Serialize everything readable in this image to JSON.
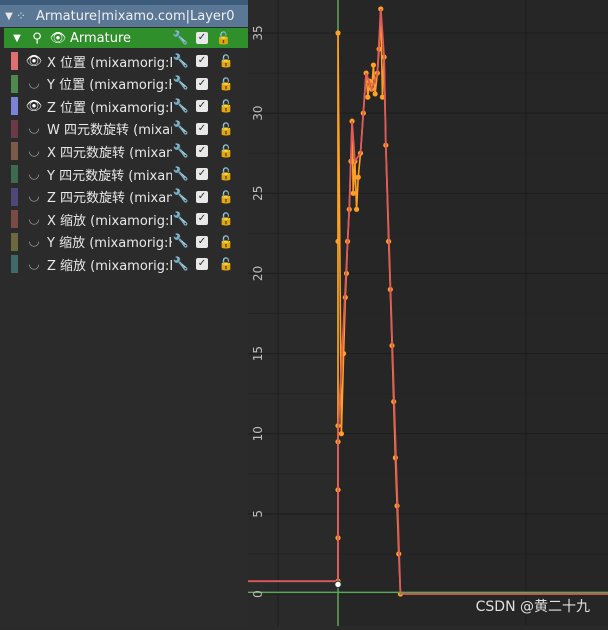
{
  "panel": {
    "action": {
      "label": "Armature|mixamo.com|Layer0"
    },
    "object": {
      "label": "Armature"
    },
    "channels": [
      {
        "label": "X 位置 (mixamorig:H",
        "color": "#e07070",
        "visible": true
      },
      {
        "label": "Y 位置 (mixamorig:H",
        "color": "#4e8a4e",
        "visible": false
      },
      {
        "label": "Z 位置 (mixamorig:H",
        "color": "#7b83d8",
        "visible": true
      },
      {
        "label": "W 四元数旋转 (mixar",
        "color": "#6a3a48",
        "visible": false
      },
      {
        "label": "X 四元数旋转 (mixan",
        "color": "#7a5a48",
        "visible": false
      },
      {
        "label": "Y 四元数旋转 (mixan",
        "color": "#3e6a50",
        "visible": false
      },
      {
        "label": "Z 四元数旋转 (mixan",
        "color": "#4e4878",
        "visible": false
      },
      {
        "label": "X 缩放 (mixamorig:H",
        "color": "#7a4a44",
        "visible": false
      },
      {
        "label": "Y 缩放 (mixamorig:H",
        "color": "#6a6a3e",
        "visible": false
      },
      {
        "label": "Z 缩放 (mixamorig:H",
        "color": "#3e6a6a",
        "visible": false
      }
    ],
    "icons": {
      "eye": "eye-icon",
      "wrench": "wrench-icon",
      "check": "checkbox-icon",
      "lock": "unlock-icon"
    }
  },
  "chart_data": {
    "type": "line",
    "ylim": [
      -0.5,
      37
    ],
    "y_ticks": [
      "0",
      "5",
      "10",
      "15",
      "20",
      "25",
      "30",
      "35"
    ],
    "y_tick_values": [
      0,
      5,
      10,
      15,
      20,
      25,
      30,
      35
    ],
    "series": [
      {
        "color": "#ffa024",
        "points": [
          [
            0,
            0.8
          ],
          [
            0,
            3.5
          ],
          [
            0,
            6.5
          ],
          [
            0,
            9.5
          ],
          [
            0,
            10.5
          ],
          [
            0,
            22
          ],
          [
            0,
            35
          ],
          [
            0.6,
            10
          ],
          [
            1,
            15
          ],
          [
            1.3,
            18.5
          ],
          [
            1.5,
            20
          ],
          [
            1.7,
            22
          ],
          [
            2,
            24
          ],
          [
            2.3,
            27
          ],
          [
            2.5,
            29.5
          ],
          [
            2.7,
            25
          ],
          [
            3,
            27
          ],
          [
            3.3,
            24
          ],
          [
            3.6,
            26
          ],
          [
            4,
            27.5
          ],
          [
            4.5,
            30
          ],
          [
            5,
            32.5
          ],
          [
            5.3,
            31
          ],
          [
            5.6,
            32
          ],
          [
            6,
            31.5
          ],
          [
            6.3,
            33
          ],
          [
            6.6,
            31.2
          ],
          [
            7,
            32.5
          ],
          [
            7.3,
            34
          ],
          [
            7.6,
            36.5
          ],
          [
            7.9,
            31
          ],
          [
            8.2,
            33.5
          ],
          [
            8.5,
            28
          ],
          [
            9,
            22
          ],
          [
            9.3,
            19
          ],
          [
            9.6,
            15.5
          ],
          [
            9.9,
            12
          ],
          [
            10.2,
            8.5
          ],
          [
            10.5,
            5.5
          ],
          [
            10.8,
            2.5
          ],
          [
            11.1,
            0
          ]
        ]
      },
      {
        "color": "#e05a5a",
        "points": [
          [
            -16,
            0.8
          ],
          [
            0,
            0.8
          ],
          [
            0,
            10
          ],
          [
            2,
            24
          ],
          [
            2.5,
            29.5
          ],
          [
            3,
            27
          ],
          [
            4,
            27.5
          ],
          [
            5,
            32.5
          ],
          [
            6,
            31.5
          ],
          [
            7,
            32.5
          ],
          [
            7.6,
            36.5
          ],
          [
            8.2,
            33.5
          ],
          [
            8.5,
            28
          ],
          [
            11.1,
            0
          ],
          [
            48,
            0
          ]
        ]
      },
      {
        "color": "#58a858",
        "points": [
          [
            -16,
            0.1
          ],
          [
            48,
            0.1
          ]
        ]
      }
    ],
    "x_range": [
      -16,
      48
    ],
    "cursor_x": 0
  },
  "watermark": "CSDN @黄二十九"
}
